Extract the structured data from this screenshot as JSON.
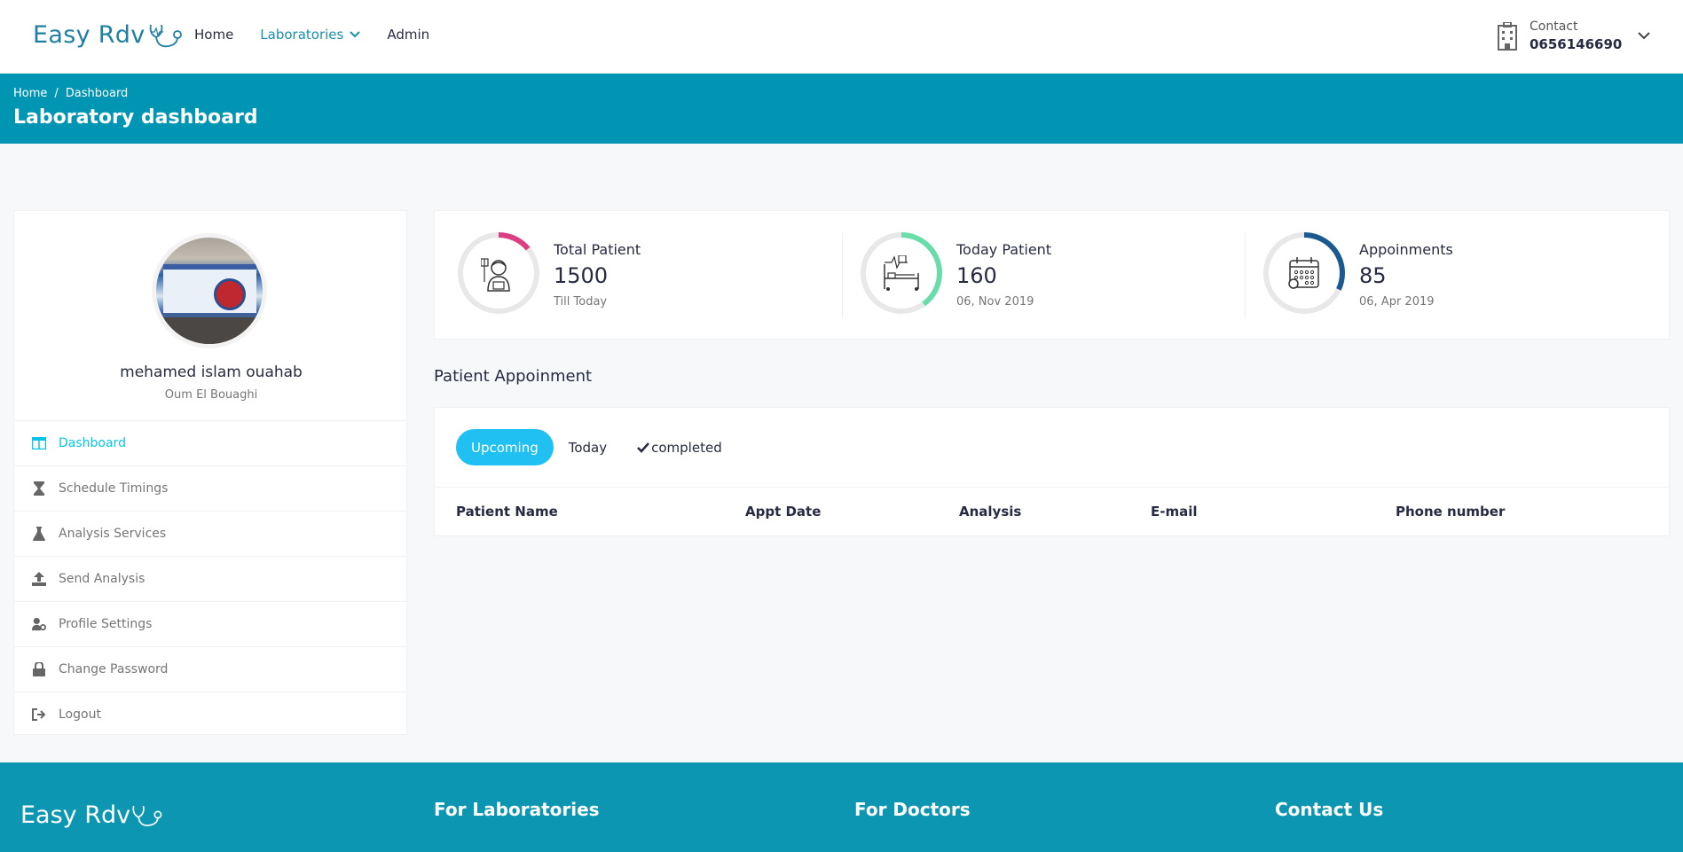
{
  "header": {
    "logo_text": "Easy Rdv",
    "nav": [
      {
        "label": "Home"
      },
      {
        "label": "Laboratories"
      },
      {
        "label": "Admin"
      }
    ],
    "contact_label": "Contact",
    "contact_phone": "0656146690"
  },
  "breadcrumb": {
    "items": [
      "Home",
      "/",
      "Dashboard"
    ],
    "title": "Laboratory dashboard"
  },
  "profile": {
    "name": "mehamed islam ouahab",
    "location": "Oum El Bouaghi"
  },
  "menu": [
    {
      "label": "Dashboard",
      "icon": "columns-icon"
    },
    {
      "label": "Schedule Timings",
      "icon": "hourglass-icon"
    },
    {
      "label": "Analysis Services",
      "icon": "flask-icon"
    },
    {
      "label": "Send Analysis",
      "icon": "upload-icon"
    },
    {
      "label": "Profile Settings",
      "icon": "user-cog-icon"
    },
    {
      "label": "Change Password",
      "icon": "lock-icon"
    },
    {
      "label": "Logout",
      "icon": "sign-out-icon"
    }
  ],
  "stats": [
    {
      "label": "Total Patient",
      "value": "1500",
      "sub": "Till Today",
      "color": "#da3f81",
      "progress": 0.14
    },
    {
      "label": "Today Patient",
      "value": "160",
      "sub": "06, Nov 2019",
      "color": "#68dda9",
      "progress": 0.4
    },
    {
      "label": "Appoinments",
      "value": "85",
      "sub": "06, Apr 2019",
      "color": "#1b5a90",
      "progress": 0.32
    }
  ],
  "appointments": {
    "title": "Patient Appoinment",
    "tabs": [
      "Upcoming",
      "Today",
      "completed"
    ],
    "columns": [
      "Patient Name",
      "Appt Date",
      "Analysis",
      "E-mail",
      "Phone number"
    ]
  },
  "footer": {
    "logo_text": "Easy Rdv",
    "columns": [
      "For Laboratories",
      "For Doctors",
      "Contact Us"
    ]
  },
  "colors": {
    "primary": "#0095b3",
    "accent": "#20c0f3",
    "footer": "#0d96b2"
  }
}
